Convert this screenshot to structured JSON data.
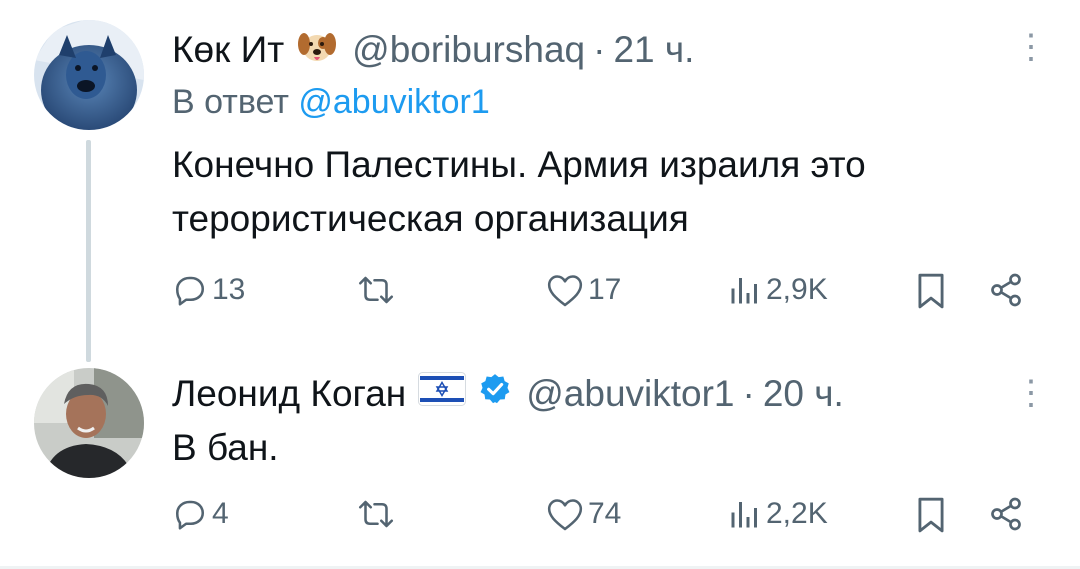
{
  "tweets": [
    {
      "name": "Көк Ит",
      "name_emoji": "dog-face",
      "handle": "@boriburshaq",
      "dot": "·",
      "time": "21 ч.",
      "reply_prefix": "В ответ",
      "reply_to": "@abuviktor1",
      "text_lines": [
        "Конечно Палестины. Армия израиля это",
        "терористическая организация"
      ],
      "counts": {
        "replies": "13",
        "likes": "17",
        "views": "2,9K"
      }
    },
    {
      "name": "Леонид Коган",
      "flag": "israel-flag",
      "verified": true,
      "handle": "@abuviktor1",
      "dot": "·",
      "time": "20 ч.",
      "text": "В бан.",
      "counts": {
        "replies": "4",
        "likes": "74",
        "views": "2,2K"
      }
    }
  ],
  "more_glyph": "⋮",
  "colors": {
    "link": "#1d9bf0",
    "muted": "#536471",
    "text": "#0f1419",
    "verified": "#1d9bf0",
    "thread": "#cfd9de"
  }
}
